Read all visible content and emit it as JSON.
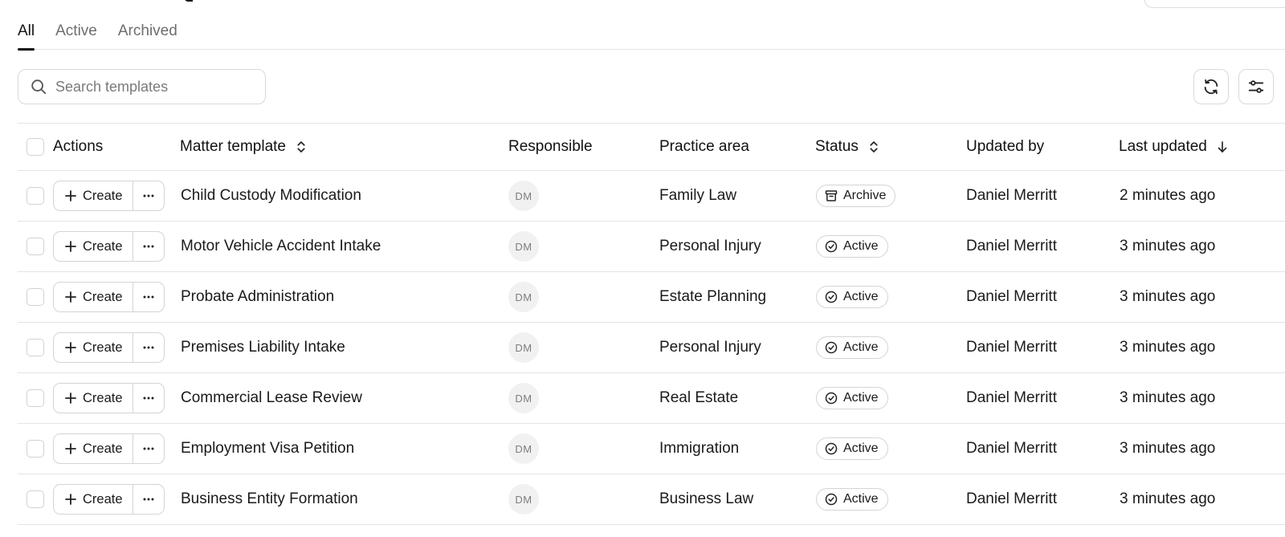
{
  "tabs": [
    {
      "label": "All",
      "active": true
    },
    {
      "label": "Active",
      "active": false
    },
    {
      "label": "Archived",
      "active": false
    }
  ],
  "search": {
    "placeholder": "Search templates",
    "value": ""
  },
  "toolbar": {
    "refresh_icon": "refresh-icon",
    "filter_icon": "sliders-icon"
  },
  "columns": {
    "actions": "Actions",
    "template": "Matter template",
    "responsible": "Responsible",
    "practice_area": "Practice area",
    "status": "Status",
    "updated_by": "Updated by",
    "last_updated": "Last updated"
  },
  "create_label": "Create",
  "rows": [
    {
      "template": "Child Custody Modification",
      "responsible": "DM",
      "practice_area": "Family Law",
      "status": "Archive",
      "updated_by": "Daniel Merritt",
      "last_updated": "2 minutes ago"
    },
    {
      "template": "Motor Vehicle Accident Intake",
      "responsible": "DM",
      "practice_area": "Personal Injury",
      "status": "Active",
      "updated_by": "Daniel Merritt",
      "last_updated": "3 minutes ago"
    },
    {
      "template": "Probate Administration",
      "responsible": "DM",
      "practice_area": "Estate Planning",
      "status": "Active",
      "updated_by": "Daniel Merritt",
      "last_updated": "3 minutes ago"
    },
    {
      "template": "Premises Liability Intake",
      "responsible": "DM",
      "practice_area": "Personal Injury",
      "status": "Active",
      "updated_by": "Daniel Merritt",
      "last_updated": "3 minutes ago"
    },
    {
      "template": "Commercial Lease Review",
      "responsible": "DM",
      "practice_area": "Real Estate",
      "status": "Active",
      "updated_by": "Daniel Merritt",
      "last_updated": "3 minutes ago"
    },
    {
      "template": "Employment Visa Petition",
      "responsible": "DM",
      "practice_area": "Immigration",
      "status": "Active",
      "updated_by": "Daniel Merritt",
      "last_updated": "3 minutes ago"
    },
    {
      "template": "Business Entity Formation",
      "responsible": "DM",
      "practice_area": "Business Law",
      "status": "Active",
      "updated_by": "Daniel Merritt",
      "last_updated": "3 minutes ago"
    }
  ]
}
